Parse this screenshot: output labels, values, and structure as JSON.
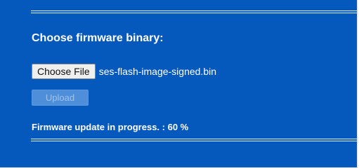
{
  "firmware": {
    "heading": "Choose firmware binary:",
    "choose_button_label": "Choose File",
    "selected_file": "ses-flash-image-signed.bin",
    "upload_button_label": "Upload",
    "upload_enabled": false,
    "status_text": "Firmware update in progress. : 60 %",
    "progress_percent": 60
  },
  "colors": {
    "panel_background": "#0559bd",
    "text": "#ffffff",
    "disabled_button": "#4f8fd9"
  }
}
